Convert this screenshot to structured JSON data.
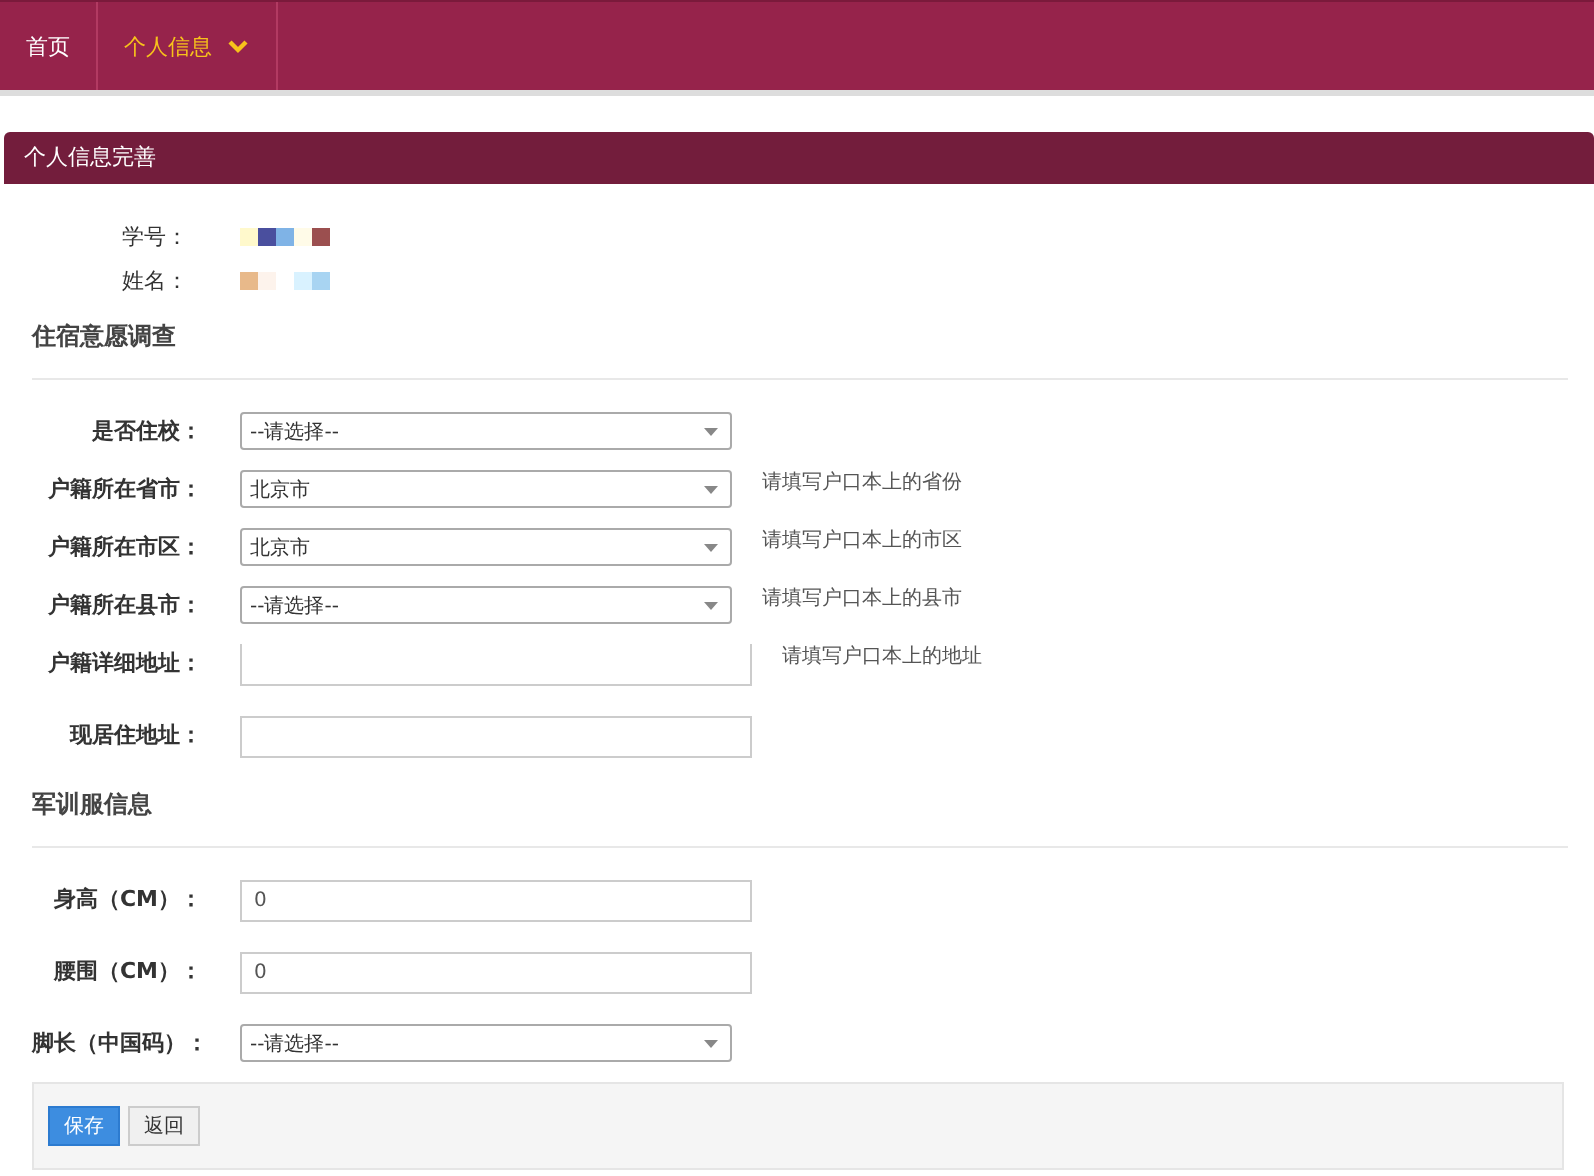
{
  "nav": {
    "items": [
      {
        "label": "首页",
        "selected": false,
        "dropdown": false
      },
      {
        "label": "个人信息",
        "selected": true,
        "dropdown": true
      }
    ]
  },
  "panel": {
    "title": "个人信息完善",
    "info": [
      {
        "label": "学号："
      },
      {
        "label": "姓名："
      }
    ],
    "sections": [
      {
        "title": "住宿意愿调查",
        "fields": [
          {
            "kind": "select",
            "label": "是否住校：",
            "value": "--请选择--"
          },
          {
            "kind": "select",
            "label": "户籍所在省市：",
            "value": "北京市",
            "hint": "请填写户口本上的省份"
          },
          {
            "kind": "select",
            "label": "户籍所在市区：",
            "value": "北京市",
            "hint": "请填写户口本上的市区"
          },
          {
            "kind": "select",
            "label": "户籍所在县市：",
            "value": "--请选择--",
            "hint": "请填写户口本上的县市"
          },
          {
            "kind": "textarea",
            "label": "户籍详细地址：",
            "hint": "请填写户口本上的地址"
          },
          {
            "kind": "input",
            "label": "现居住地址："
          }
        ]
      },
      {
        "title": "军训服信息",
        "fields": [
          {
            "kind": "input",
            "label": "身高（CM）：",
            "value": "0"
          },
          {
            "kind": "input",
            "label": "腰围（CM）：",
            "value": "0"
          },
          {
            "kind": "select",
            "label": "脚长（中国码）：",
            "value": "--请选择--"
          }
        ]
      }
    ],
    "buttons": [
      {
        "label": "保存",
        "kind": "primary"
      },
      {
        "label": "返回",
        "kind": "default"
      }
    ]
  }
}
